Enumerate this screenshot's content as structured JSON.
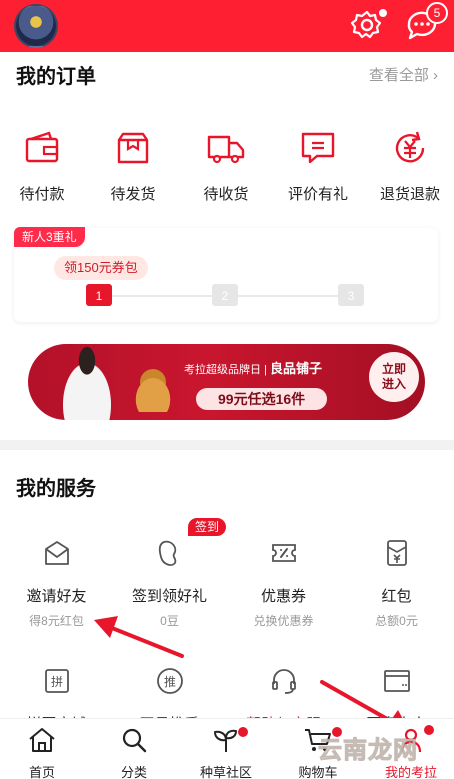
{
  "header": {
    "message_count": "5"
  },
  "orders": {
    "title": "我的订单",
    "see_all": "查看全部 ›",
    "items": [
      {
        "label": "待付款",
        "icon": "wallet-icon"
      },
      {
        "label": "待发货",
        "icon": "package-icon"
      },
      {
        "label": "待收货",
        "icon": "truck-icon"
      },
      {
        "label": "评价有礼",
        "icon": "comment-icon"
      },
      {
        "label": "退货退款",
        "icon": "refund-icon"
      }
    ]
  },
  "newcomer": {
    "tag": "新人3重礼",
    "coupon": "领150元券包",
    "steps": [
      "1",
      "2",
      "3"
    ],
    "current_step": 1
  },
  "banner": {
    "brand_left": "考拉超级品牌日",
    "brand_right": "良品铺子",
    "deal": "99元任选16件",
    "cta": "立即\n进入"
  },
  "services": {
    "title": "我的服务",
    "signin_badge": "签到",
    "items": [
      {
        "name": "邀请好友",
        "sub": "得8元红包",
        "icon": "invite-mail-icon"
      },
      {
        "name": "签到领好礼",
        "sub": "0豆",
        "icon": "bean-icon"
      },
      {
        "name": "优惠券",
        "sub": "兑换优惠券",
        "icon": "coupon-icon"
      },
      {
        "name": "红包",
        "sub": "总额0元",
        "icon": "red-envelope-icon"
      }
    ],
    "row2": [
      {
        "name": "拼团商城",
        "icon": "group-buy-icon"
      },
      {
        "name": "网易推手",
        "icon": "promote-icon"
      },
      {
        "name": "帮助与客服",
        "icon": "headset-icon"
      },
      {
        "name": "更多内容",
        "icon": "window-icon"
      }
    ]
  },
  "nav": {
    "items": [
      {
        "label": "首页",
        "icon": "home-icon"
      },
      {
        "label": "分类",
        "icon": "search-icon"
      },
      {
        "label": "种草社区",
        "icon": "sprout-icon"
      },
      {
        "label": "购物车",
        "icon": "cart-icon"
      },
      {
        "label": "我的考拉",
        "icon": "profile-icon"
      }
    ]
  },
  "watermark": "云南龙网",
  "colors": {
    "brand_red": "#ff1f33",
    "accent_red": "#e8162b"
  }
}
